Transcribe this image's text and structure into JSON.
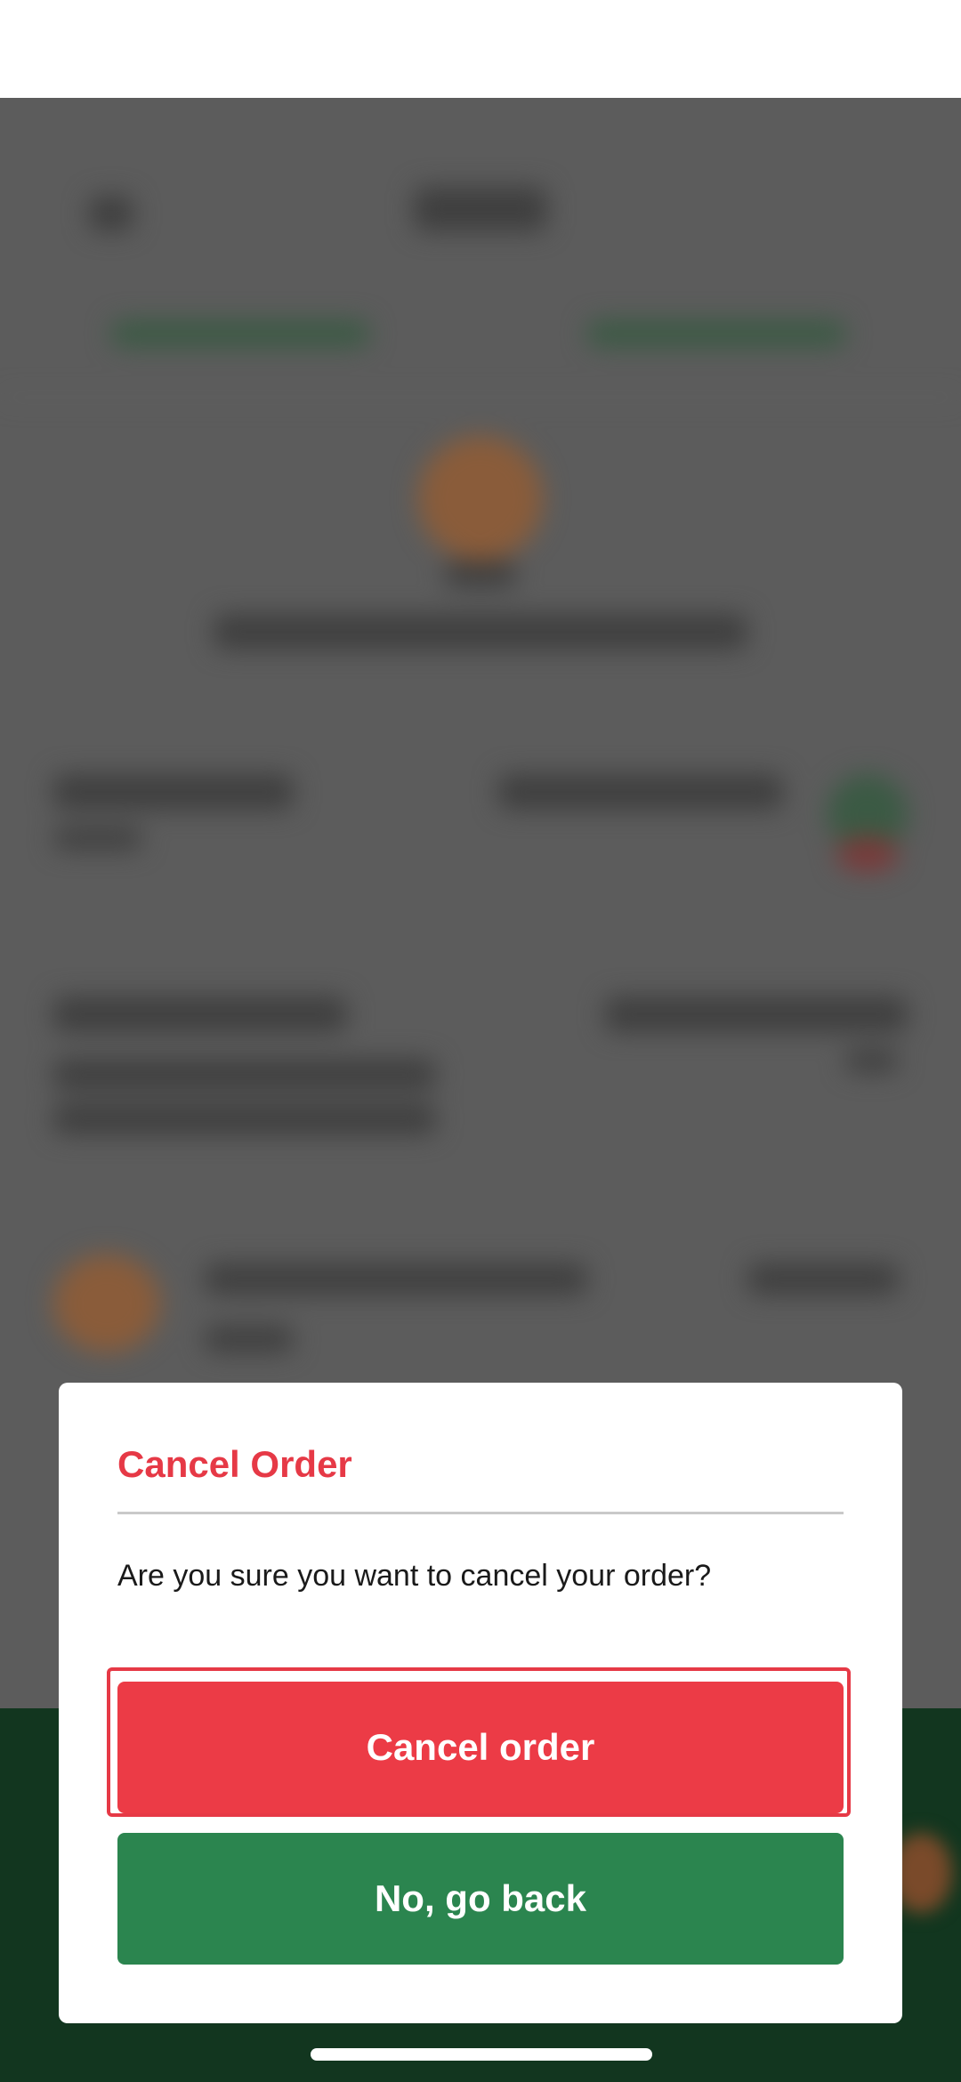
{
  "dialog": {
    "title": "Cancel Order",
    "message": "Are you sure you want to cancel your order?",
    "confirm_label": "Cancel order",
    "dismiss_label": "No, go back"
  },
  "colors": {
    "title": "#e63946",
    "confirm_button": "#ec3b46",
    "dismiss_button": "#2b854f",
    "overlay": "#5c5c5c"
  }
}
